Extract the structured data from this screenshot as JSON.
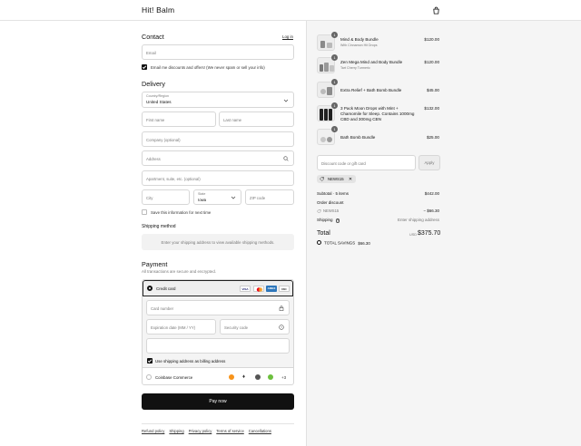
{
  "header": {
    "brand": "Hit! Balm"
  },
  "contact": {
    "heading": "Contact",
    "login_link": "Log in",
    "email_placeholder": "Email",
    "marketing_label": "Email me discounts and offers! (We never spam or sell your info)"
  },
  "delivery": {
    "heading": "Delivery",
    "country_label": "Country/Region",
    "country_value": "United States",
    "first_name_placeholder": "First name",
    "last_name_placeholder": "Last name",
    "company_placeholder": "Company (optional)",
    "address_placeholder": "Address",
    "apartment_placeholder": "Apartment, suite, etc. (optional)",
    "city_placeholder": "City",
    "state_label": "State",
    "state_value": "Iowa",
    "zip_placeholder": "ZIP code",
    "save_info_label": "Save this information for next time"
  },
  "shipping": {
    "heading": "Shipping method",
    "message": "Enter your shipping address to view available shipping methods."
  },
  "payment": {
    "heading": "Payment",
    "subtitle": "All transactions are secure and encrypted.",
    "credit_card_label": "Credit card",
    "cards": [
      {
        "name": "VISA",
        "color": "#1a1f71",
        "bg": "#ffffff"
      },
      {
        "name": "MC",
        "color": "#ffffff",
        "bg": "#f6f6f6"
      },
      {
        "name": "AMEX",
        "color": "#ffffff",
        "bg": "#2e77bb"
      },
      {
        "name": "DISCOVER",
        "color": "#333333",
        "bg": "#ffffff"
      }
    ],
    "card_number_placeholder": "Card number",
    "expiration_placeholder": "Expiration date (MM / YY)",
    "security_placeholder": "Security code",
    "billing_label": "Use shipping address as billing address",
    "coinbase_label": "Coinbase Commerce",
    "coinbase_more": "+3",
    "pay_button": "Pay now"
  },
  "footer_links": [
    "Refund policy",
    "Shipping",
    "Privacy policy",
    "Terms of service",
    "Cancellations"
  ],
  "cart": {
    "items": [
      {
        "name": "Mind & Body Bundle",
        "sub": "With Cinnamon Hit Drops",
        "price": "$120.00",
        "qty": "1"
      },
      {
        "name": "Zen Mega Mind and Body Bundle",
        "sub": "Tart Cherry Turmeric",
        "price": "$120.00",
        "qty": "1"
      },
      {
        "name": "Extra Relief + Bath Bomb Bundle",
        "sub": "",
        "price": "$45.00",
        "qty": "1"
      },
      {
        "name": "3 Pack Moon Drops with Mint + Chamomile for Sleep. Contains 1000mg CBD and 300mg CBN",
        "sub": "",
        "price": "$132.00",
        "qty": "1"
      },
      {
        "name": "Bath Bomb Bundle",
        "sub": "",
        "price": "$25.00",
        "qty": "1"
      }
    ],
    "discount_placeholder": "Discount code or gift card",
    "apply_label": "Apply",
    "applied_code": "NEWS15",
    "subtotal_label": "Subtotal · 5 items",
    "subtotal_value": "$442.00",
    "order_discount_label": "Order discount",
    "discount_code": "NEWS15",
    "discount_value": "− $66.30",
    "shipping_label": "Shipping",
    "shipping_value": "Enter shipping address",
    "total_label": "Total",
    "currency": "USD",
    "total_value": "$375.70",
    "savings_label": "TOTAL SAVINGS",
    "savings_value": "$66.30"
  }
}
